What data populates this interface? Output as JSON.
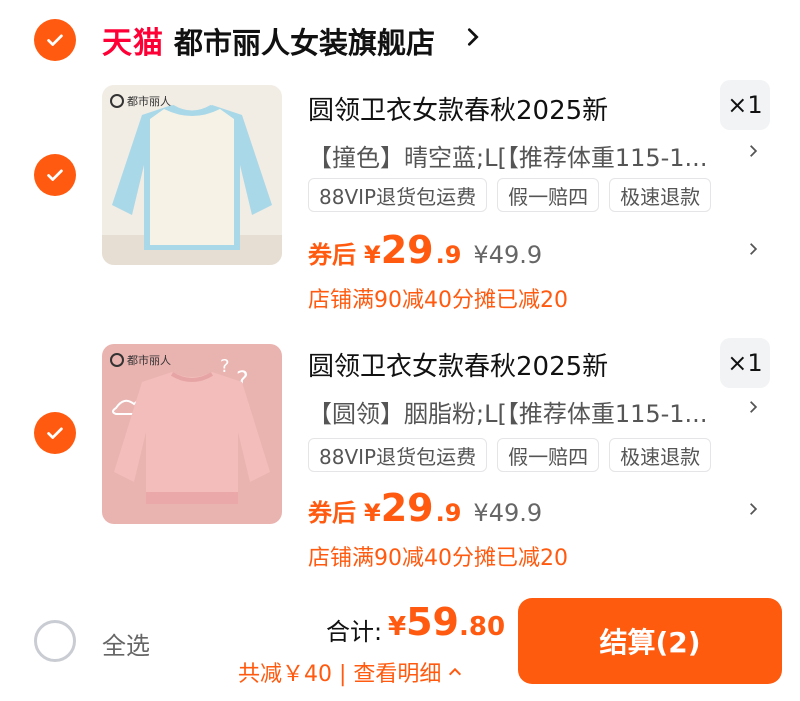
{
  "shop": {
    "brand": "天猫",
    "name": "都市丽人女装旗舰店"
  },
  "items": [
    {
      "title": "圆领卫衣女款春秋2025新",
      "quantity": "×1",
      "sku": "【撞色】晴空蓝;L[【推荐体重115-1...",
      "tags": [
        "88VIP退货包运费",
        "假一赔四",
        "极速退款"
      ],
      "price_prefix": "券后",
      "currency": "¥",
      "price_int": "29",
      "price_dec": ".9",
      "original_price": "¥49.9",
      "promo": "店铺满90减40分摊已减20",
      "thumb_logo": "都市丽人",
      "thumb_colors": {
        "bg": "#f1ece4",
        "body": "#f7f2e6",
        "sleeve": "#a9d8e8"
      }
    },
    {
      "title": "圆领卫衣女款春秋2025新",
      "quantity": "×1",
      "sku": "【圆领】胭脂粉;L[【推荐体重115-1...",
      "tags": [
        "88VIP退货包运费",
        "假一赔四",
        "极速退款"
      ],
      "price_prefix": "券后",
      "currency": "¥",
      "price_int": "29",
      "price_dec": ".9",
      "original_price": "¥49.9",
      "promo": "店铺满90减40分摊已减20",
      "thumb_logo": "都市丽人",
      "thumb_colors": {
        "bg": "#e9b3b0",
        "body": "#f2bdbb",
        "sleeve": "#f2bdbb"
      }
    }
  ],
  "bottom": {
    "select_all": "全选",
    "total_label": "合计:",
    "total_currency": "¥",
    "total_int": "59",
    "total_dec": ".80",
    "savings": "共减￥40 | 查看明细",
    "checkout": "结算(2)"
  },
  "colors": {
    "accent": "#ff5a0f",
    "tmall_red": "#ff0036"
  }
}
